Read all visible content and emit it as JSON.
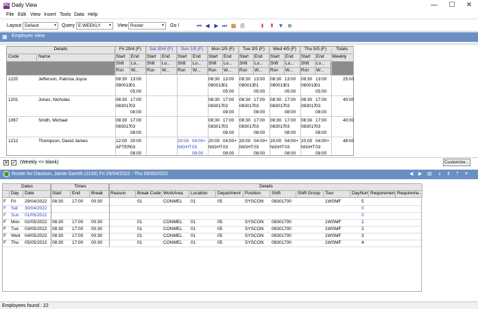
{
  "window": {
    "title": "Daily View",
    "icon_text": "PC",
    "min": "—",
    "max": "☐",
    "close": "✕"
  },
  "menu": [
    "File",
    "Edit",
    "View",
    "Insert",
    "Tools",
    "Data",
    "Help"
  ],
  "toolbar": {
    "layout_label": "Layout",
    "layout_value": "Default",
    "query_label": "Query",
    "query_value": "E.WEEKLY",
    "view_label": "View",
    "view_value": "Roster",
    "go_label": "Go !"
  },
  "employee_panel": {
    "title": "Employee View"
  },
  "grid": {
    "details_header": "Details",
    "code_header": "Code",
    "name_header": "Name",
    "totals_header": "Totals",
    "weekly_header": "Weekly",
    "days": [
      {
        "label": "Fri 29/4 (F)",
        "color": "#000000"
      },
      {
        "label": "Sat 30/4 (F)",
        "color": "#2a3fd1"
      },
      {
        "label": "Sun 1/5 (F)",
        "color": "#2a3fd1"
      },
      {
        "label": "Mon 2/5 (F)",
        "color": "#000000"
      },
      {
        "label": "Tue 3/5 (F)",
        "color": "#000000"
      },
      {
        "label": "Wed 4/5 (F)",
        "color": "#000000"
      },
      {
        "label": "Thu 5/5 (F)",
        "color": "#000000"
      }
    ],
    "sub1": [
      "Start",
      "End"
    ],
    "sub2": [
      "Shft",
      "Lo..."
    ],
    "sub3": [
      "Rsn",
      "W..."
    ],
    "rows": [
      {
        "code": "1220",
        "name": "Jefferson, Patricia Joyce",
        "total": "25:00",
        "days": [
          [
            "08:30",
            "13:00",
            "080013",
            "01",
            "",
            "05:00"
          ],
          [
            "",
            "",
            "",
            "",
            "",
            ""
          ],
          [
            "",
            "",
            "",
            "",
            "",
            ""
          ],
          [
            "08:30",
            "13:00",
            "080013",
            "01",
            "",
            "05:00"
          ],
          [
            "08:30",
            "13:00",
            "080013",
            "01",
            "",
            "05:00"
          ],
          [
            "08:30",
            "13:00",
            "080013",
            "01",
            "",
            "05:00"
          ],
          [
            "08:30",
            "13:00",
            "080013",
            "01",
            "",
            "05:00"
          ]
        ]
      },
      {
        "code": "1201",
        "name": "Jones, Nicholas",
        "total": "40:00",
        "days": [
          [
            "08:30",
            "17:00",
            "083017",
            "03",
            "",
            "08:00"
          ],
          [
            "",
            "",
            "",
            "",
            "",
            ""
          ],
          [
            "",
            "",
            "",
            "",
            "",
            ""
          ],
          [
            "08:30",
            "17:00",
            "083017",
            "03",
            "",
            "08:00"
          ],
          [
            "08:30",
            "17:00",
            "083017",
            "03",
            "",
            "08:00"
          ],
          [
            "08:30",
            "17:00",
            "083017",
            "03",
            "",
            "08:00"
          ],
          [
            "08:30",
            "17:00",
            "083017",
            "03",
            "",
            "08:00"
          ]
        ]
      },
      {
        "code": "1067",
        "name": "Smith, Michael",
        "total": "40:00",
        "days": [
          [
            "08:30",
            "17:00",
            "083017",
            "03",
            "",
            "08:00"
          ],
          [
            "",
            "",
            "",
            "",
            "",
            ""
          ],
          [
            "",
            "",
            "",
            "",
            "",
            ""
          ],
          [
            "08:30",
            "17:00",
            "083017",
            "03",
            "",
            "08:00"
          ],
          [
            "08:30",
            "17:00",
            "083017",
            "03",
            "",
            "08:00"
          ],
          [
            "08:30",
            "17:00",
            "083017",
            "03",
            "",
            "08:00"
          ],
          [
            "08:30",
            "17:00",
            "083017",
            "03",
            "",
            "08:00"
          ]
        ]
      },
      {
        "code": "1212",
        "name": "Thompson, David James",
        "total": "48:00",
        "days": [
          [
            "12:00",
            "20:00",
            "AFTER",
            "03",
            "",
            "08:00"
          ],
          [
            "",
            "",
            "",
            "",
            "",
            ""
          ],
          [
            "20:00",
            "04:00+",
            "NIGHT",
            "03",
            "",
            "08:00"
          ],
          [
            "20:00",
            "04:00+",
            "NIGHT",
            "03",
            "",
            "08:00"
          ],
          [
            "20:00",
            "04:00+",
            "NIGHT",
            "03",
            "",
            "08:00"
          ],
          [
            "20:00",
            "04:00+",
            "NIGHT",
            "03",
            "",
            "08:00"
          ],
          [
            "20:00",
            "04:00+",
            "NIGHT",
            "03",
            "",
            "08:00"
          ]
        ]
      }
    ]
  },
  "filter": {
    "text": "(Weekly <> blank)",
    "customize": "Customize..."
  },
  "roster_panel": {
    "title": "Roster for Davison, Jamie Gareth (1105) Fri 29/04/2022 - Thu 05/05/2022"
  },
  "roster": {
    "group_headers": [
      "Dates",
      "Times",
      "Details"
    ],
    "columns": [
      "Day",
      "Date",
      "Start",
      "End",
      "Break",
      "Reason",
      "Break Code",
      "WorkArea",
      "Location",
      "Department",
      "Position",
      "Shift",
      "Shift Group",
      "Tour",
      "DayNum",
      "Requirement",
      "Requireme..."
    ],
    "rows": [
      {
        "flag": "F",
        "day": "Fri",
        "date": "29/04/2022",
        "start": "08:30",
        "end": "17:00",
        "break": "00:30",
        "reason": "",
        "bcode": "01",
        "area": "CONMEL",
        "loc": "01",
        "dept": "05",
        "pos": "SYSCON",
        "shift": "08301700",
        "group": "",
        "tour": "1WSMF",
        "daynum": "5",
        "blue": false
      },
      {
        "flag": "F",
        "day": "Sat",
        "date": "30/04/2022",
        "start": "",
        "end": "",
        "break": "",
        "reason": "",
        "bcode": "",
        "area": "",
        "loc": "",
        "dept": "",
        "pos": "",
        "shift": "",
        "group": "",
        "tour": "",
        "daynum": "0",
        "blue": true
      },
      {
        "flag": "F",
        "day": "Sun",
        "date": "01/05/2022",
        "start": "",
        "end": "",
        "break": "",
        "reason": "",
        "bcode": "",
        "area": "",
        "loc": "",
        "dept": "",
        "pos": "",
        "shift": "",
        "group": "",
        "tour": "",
        "daynum": "0",
        "blue": true
      },
      {
        "flag": "F",
        "day": "Mon",
        "date": "02/05/2022",
        "start": "08:30",
        "end": "17:00",
        "break": "00:30",
        "reason": "",
        "bcode": "01",
        "area": "CONMEL",
        "loc": "01",
        "dept": "05",
        "pos": "SYSCON",
        "shift": "08301700",
        "group": "",
        "tour": "1WSMF",
        "daynum": "1",
        "blue": false
      },
      {
        "flag": "F",
        "day": "Tue",
        "date": "03/05/2022",
        "start": "08:30",
        "end": "17:00",
        "break": "00:30",
        "reason": "",
        "bcode": "01",
        "area": "CONMEL",
        "loc": "01",
        "dept": "05",
        "pos": "SYSCON",
        "shift": "08301700",
        "group": "",
        "tour": "1WSMF",
        "daynum": "2",
        "blue": false
      },
      {
        "flag": "F",
        "day": "Wed",
        "date": "04/05/2022",
        "start": "08:30",
        "end": "17:00",
        "break": "00:30",
        "reason": "",
        "bcode": "01",
        "area": "CONMEL",
        "loc": "01",
        "dept": "05",
        "pos": "SYSCON",
        "shift": "08301700",
        "group": "",
        "tour": "1WSMF",
        "daynum": "3",
        "blue": false
      },
      {
        "flag": "F",
        "day": "Thu",
        "date": "05/05/2022",
        "start": "08:30",
        "end": "17:00",
        "break": "00:30",
        "reason": "",
        "bcode": "01",
        "area": "CONMEL",
        "loc": "01",
        "dept": "05",
        "pos": "SYSCON",
        "shift": "08301700",
        "group": "",
        "tour": "1WSMF",
        "daynum": "4",
        "blue": false
      }
    ]
  },
  "status": {
    "text": "Employees found : 22"
  }
}
